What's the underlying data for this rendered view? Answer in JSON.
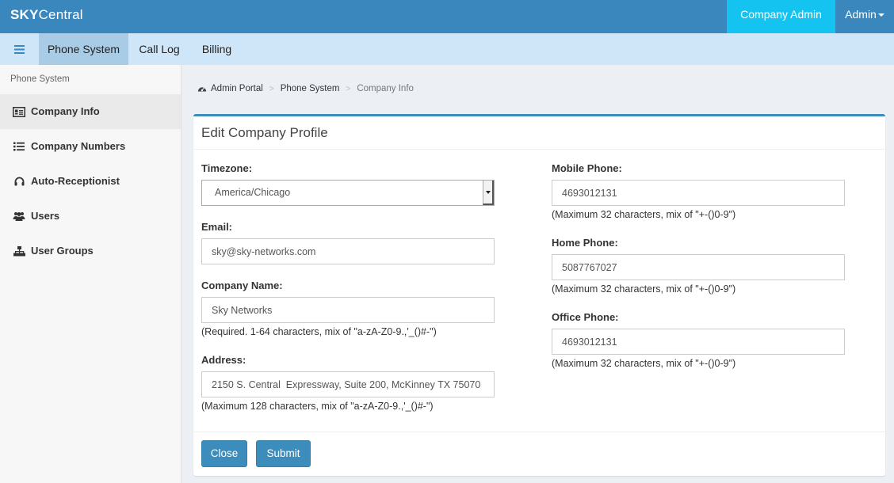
{
  "brand": {
    "bold": "SKY",
    "light": "Central"
  },
  "topbar": {
    "company_dropdown": "Company Admin",
    "admin_dropdown": "Admin"
  },
  "navbar": {
    "tabs": [
      {
        "label": "Phone System"
      },
      {
        "label": "Call Log"
      },
      {
        "label": "Billing"
      }
    ]
  },
  "sidebar": {
    "header": "Phone System",
    "items": [
      {
        "label": "Company Info"
      },
      {
        "label": "Company Numbers"
      },
      {
        "label": "Auto-Receptionist"
      },
      {
        "label": "Users"
      },
      {
        "label": "User Groups"
      }
    ]
  },
  "breadcrumb": {
    "items": [
      "Admin Portal",
      "Phone System",
      "Company Info"
    ],
    "separator": ">"
  },
  "panel": {
    "title": "Edit Company Profile",
    "timezone": {
      "label": "Timezone:",
      "value": "America/Chicago"
    },
    "email": {
      "label": "Email:",
      "value": "sky@sky-networks.com"
    },
    "company_name": {
      "label": "Company Name:",
      "value": "Sky Networks",
      "help": "(Required. 1-64 characters, mix of \"a-zA-Z0-9.,'_()#-\")"
    },
    "address": {
      "label": "Address:",
      "value": "2150 S. Central  Expressway, Suite 200, McKinney TX 75070",
      "help": "(Maximum 128 characters, mix of \"a-zA-Z0-9.,'_()#-\")"
    },
    "mobile_phone": {
      "label": "Mobile Phone:",
      "value": "4693012131",
      "help": "(Maximum 32 characters, mix of \"+-()0-9\")"
    },
    "home_phone": {
      "label": "Home Phone:",
      "value": "5087767027",
      "help": "(Maximum 32 characters, mix of \"+-()0-9\")"
    },
    "office_phone": {
      "label": "Office Phone:",
      "value": "4693012131",
      "help": "(Maximum 32 characters, mix of \"+-()0-9\")"
    },
    "close_button": "Close",
    "submit_button": "Submit"
  },
  "colors": {
    "topbar": "#3a87bd",
    "company_admin_bg": "#14c3ef",
    "navbar": "#cfe6f8",
    "navbar_active": "#a9cce6",
    "primary_button": "#3c8dbc"
  },
  "icons": {
    "menu": "hamburger-icon",
    "company_info": "id-card-icon",
    "company_numbers": "list-icon",
    "auto_receptionist": "headphones-icon",
    "users": "users-icon",
    "user_groups": "sitemap-icon",
    "admin_portal": "dashboard-icon"
  }
}
